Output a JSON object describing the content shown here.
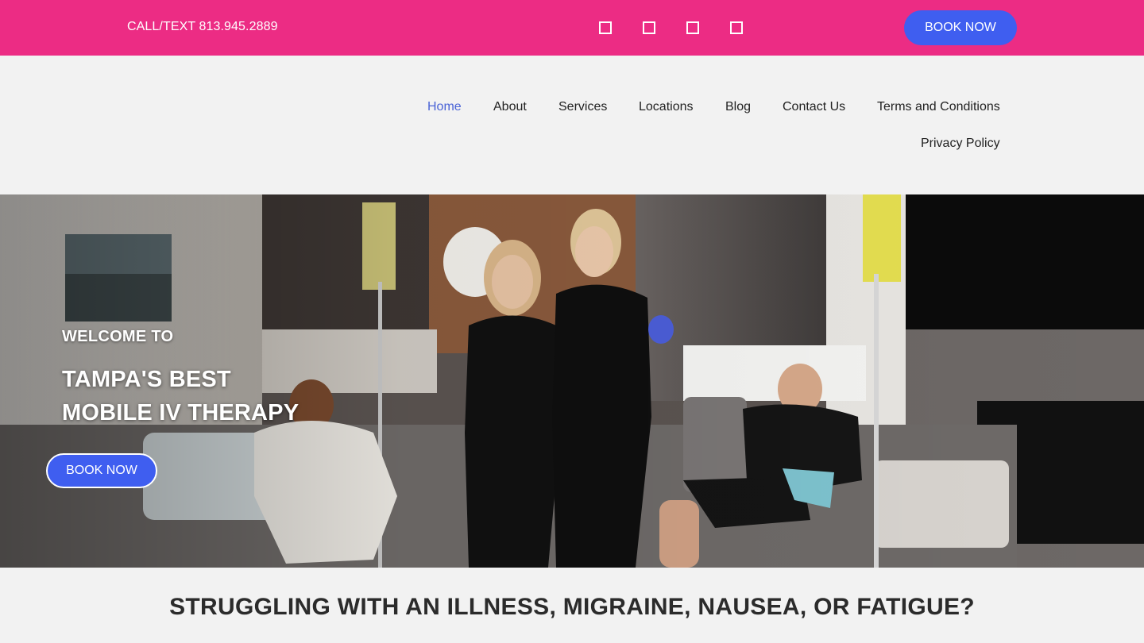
{
  "topbar": {
    "phone": "CALL/TEXT 813.945.2889",
    "social_icons": [
      "social-icon-1",
      "social-icon-2",
      "social-icon-3",
      "social-icon-4"
    ],
    "book_label": "BOOK NOW",
    "background_color": "#ec2c84",
    "button_color": "#3f5ef0"
  },
  "nav": {
    "items": [
      {
        "label": "Home",
        "active": true
      },
      {
        "label": "About"
      },
      {
        "label": "Services"
      },
      {
        "label": "Locations"
      },
      {
        "label": "Blog"
      },
      {
        "label": "Contact Us"
      },
      {
        "label": "Terms and Conditions"
      },
      {
        "label": "Privacy Policy"
      }
    ],
    "active_color": "#4a63d6"
  },
  "hero": {
    "welcome": "WELCOME TO",
    "headline_line1": "TAMPA'S BEST",
    "headline_line2": "MOBILE IV THERAPY",
    "book_label": "BOOK NOW"
  },
  "section": {
    "heading": "STRUGGLING WITH AN ILLNESS, MIGRAINE, NAUSEA, OR FATIGUE?"
  }
}
